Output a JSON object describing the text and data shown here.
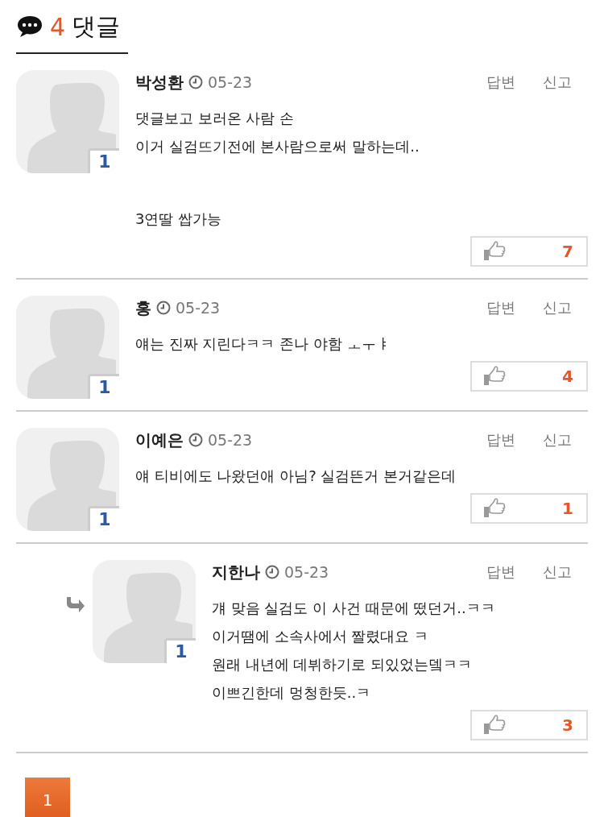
{
  "header": {
    "count": "4",
    "title": "댓글"
  },
  "comments": [
    {
      "kind": "comment",
      "badge": "1",
      "author": "박성환",
      "date": "05-23",
      "actions": [
        "답변",
        "신고"
      ],
      "paragraphs": [
        [
          "댓글보고 보러온 사람 손",
          "이거 실검뜨기전에 본사람으로써 말하는데.."
        ],
        [
          "3연딸 쌉가능"
        ]
      ],
      "likes": "7"
    },
    {
      "kind": "comment",
      "badge": "1",
      "author": "홍",
      "date": "05-23",
      "actions": [
        "답변",
        "신고"
      ],
      "paragraphs": [
        [
          "얘는 진짜 지린다ㅋㅋ 존나 야함 ㅗㅜㅑ"
        ]
      ],
      "likes": "4"
    },
    {
      "kind": "comment",
      "badge": "1",
      "author": "이예은",
      "date": "05-23",
      "actions": [
        "답변",
        "신고"
      ],
      "paragraphs": [
        [
          "얘 티비에도 나왔던애 아님? 실검뜬거 본거같은데"
        ]
      ],
      "likes": "1"
    },
    {
      "kind": "reply",
      "badge": "1",
      "author": "지한나",
      "date": "05-23",
      "actions": [
        "답변",
        "신고"
      ],
      "paragraphs": [
        [
          "걔 맞음 실검도 이 사건 때문에 떴던거..ㅋㅋ",
          "이거땜에 소속사에서 짤렸대요 ㅋ",
          "원래 내년에 데뷔하기로 되있었는뎈ㅋㅋ",
          "이쁘긴한데 멍청한듯..ㅋ"
        ]
      ],
      "likes": "3"
    }
  ],
  "pagination": [
    {
      "label": "1",
      "selected": true
    }
  ]
}
